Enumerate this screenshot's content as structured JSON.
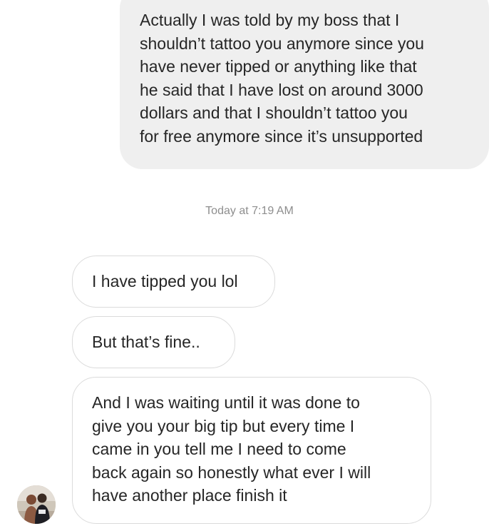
{
  "thread": {
    "messages": [
      {
        "direction": "outgoing",
        "text": "Actually I was told by my boss that I\nshouldn’t tattoo you anymore since you\nhave never tipped or anything like that\nhe said that I have lost on around 3000\ndollars and that I shouldn’t tattoo you\nfor free anymore since it’s unsupported"
      },
      {
        "direction": "incoming",
        "text": "I have tipped you lol"
      },
      {
        "direction": "incoming",
        "text": "But that’s fine.."
      },
      {
        "direction": "incoming",
        "text": "And I was waiting until it was done to\ngive you your big tip but every time I\ncame in you tell me I need to come\nback again so honestly what ever I will\nhave another place finish it"
      }
    ],
    "timestamp": "Today at 7:19 AM",
    "avatar_icon": "profile-photo-icon",
    "colors": {
      "outgoing_bubble": "#efefef",
      "incoming_border": "#dbdbdb",
      "text": "#262626",
      "timestamp": "#8e8e8e"
    }
  }
}
